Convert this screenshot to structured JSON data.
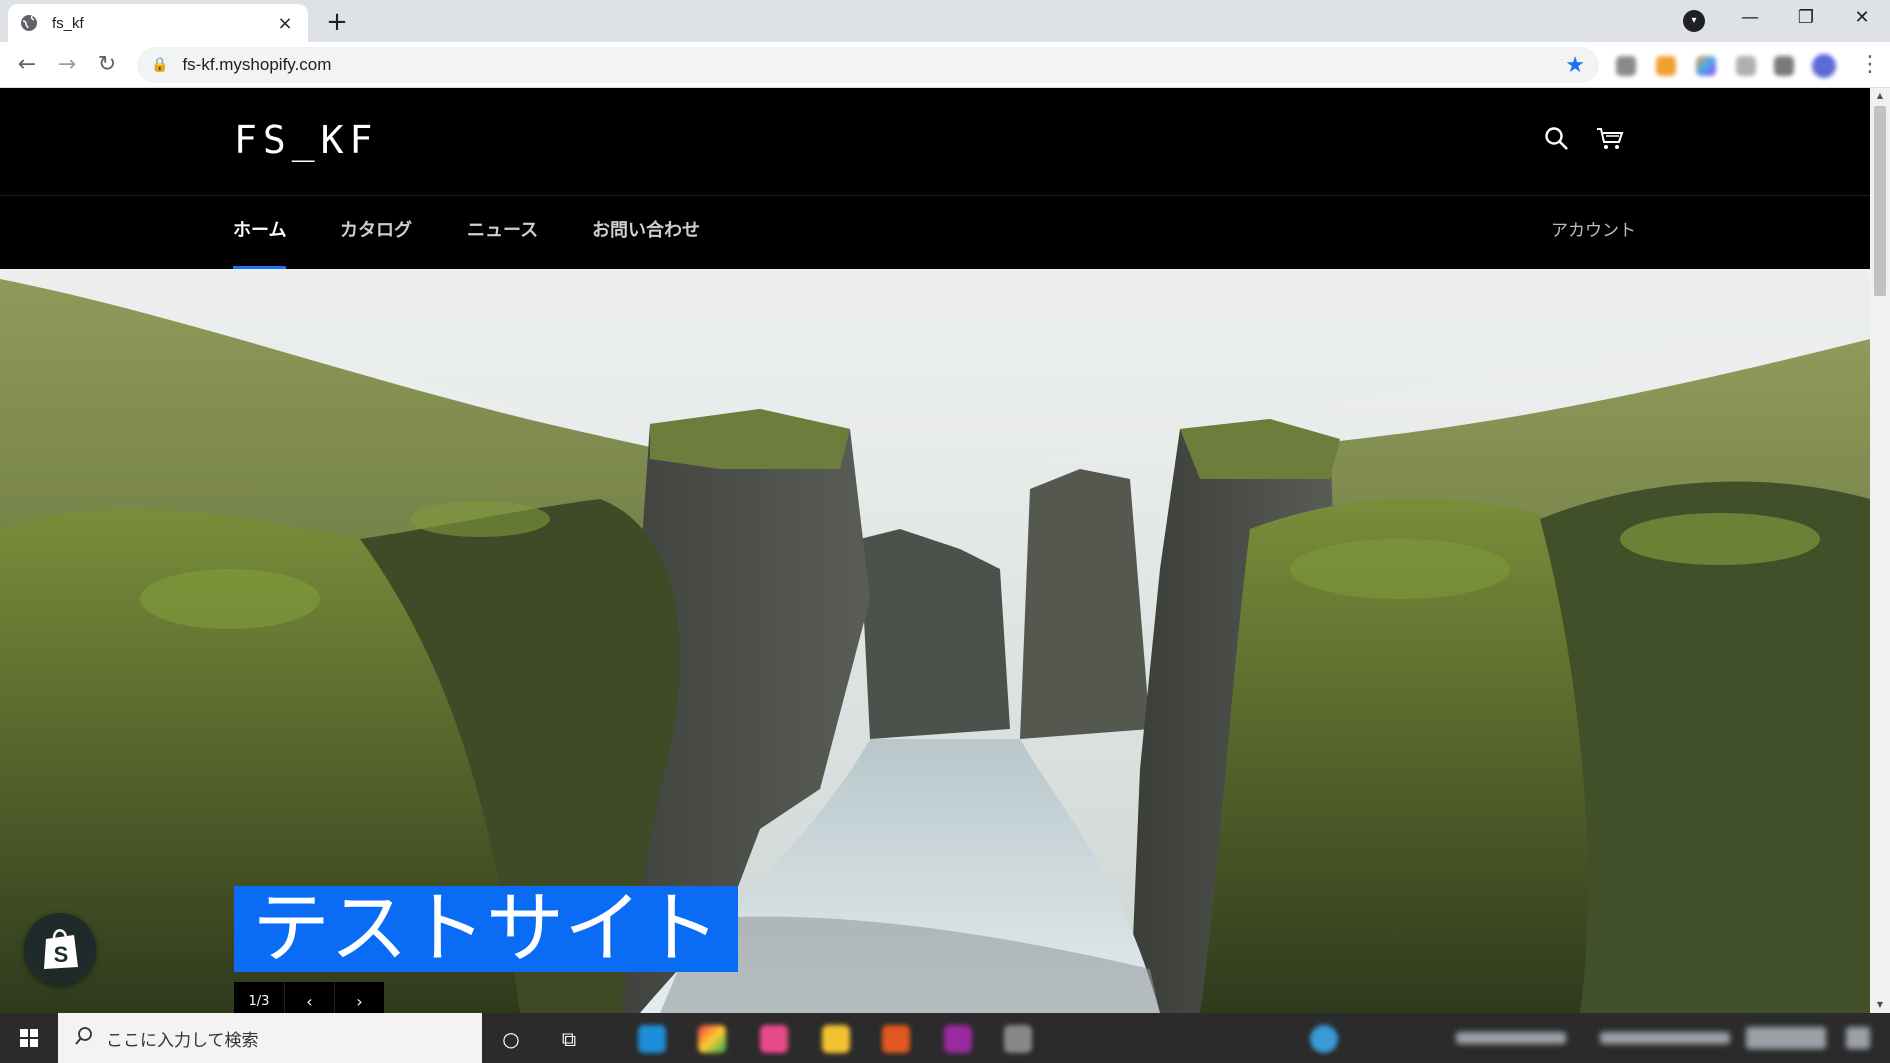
{
  "browser": {
    "tab_title": "fs_kf",
    "tab_close": "×",
    "new_tab": "+",
    "url": "fs-kf.myshopify.com",
    "window_controls": {
      "minimize": "—",
      "restore": "❐",
      "close": "✕"
    }
  },
  "site": {
    "logo": "FS_KF",
    "nav": [
      {
        "label": "ホーム",
        "active": true
      },
      {
        "label": "カタログ"
      },
      {
        "label": "ニュース"
      },
      {
        "label": "お問い合わせ"
      }
    ],
    "account_label": "アカウント",
    "hero": {
      "caption": "テストサイト",
      "slide_counter": "1/3",
      "prev": "‹",
      "next": "›"
    }
  },
  "taskbar": {
    "search_placeholder": "ここに入力して検索"
  },
  "colors": {
    "accent": "#0a6cf5",
    "header_bg": "#000000"
  }
}
